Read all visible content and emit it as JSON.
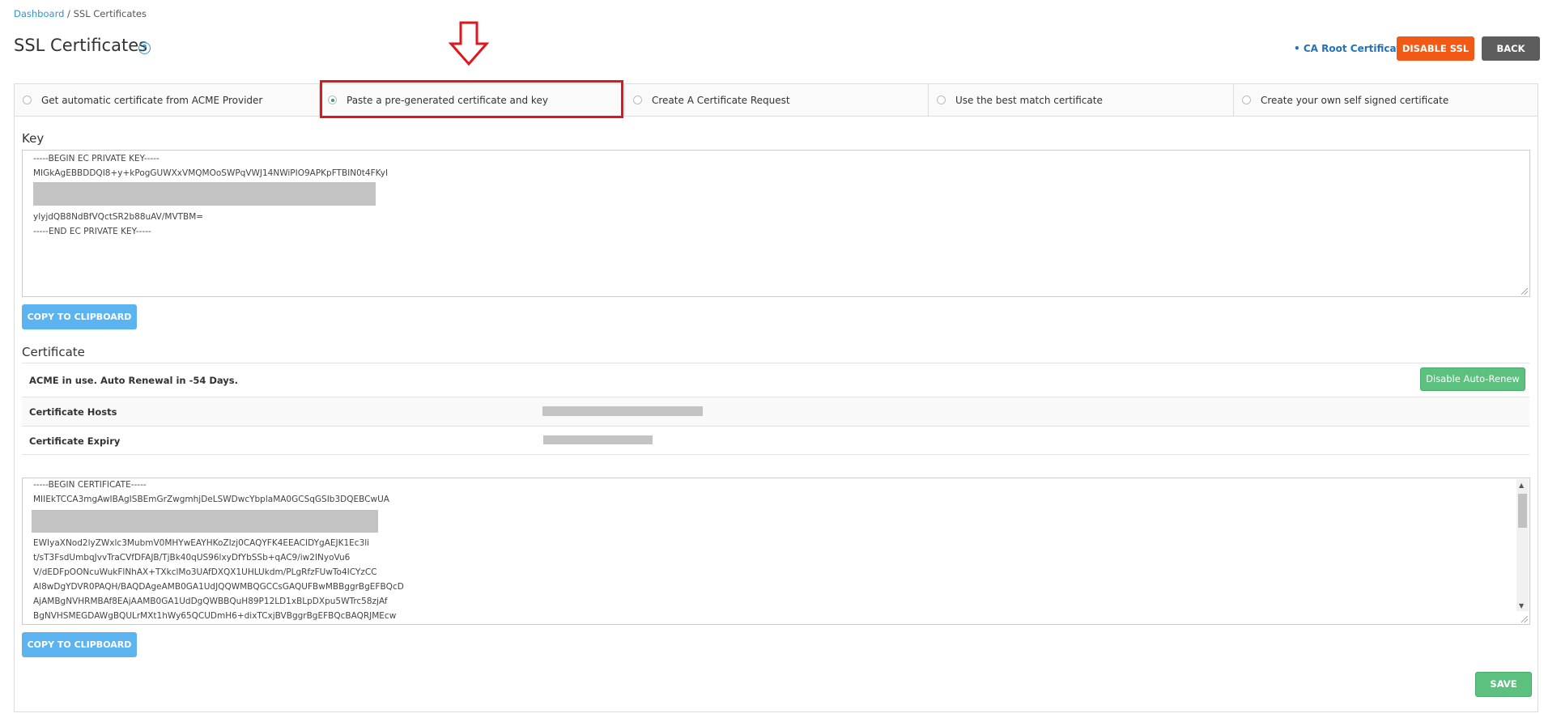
{
  "breadcrumb": {
    "home": "Dashboard",
    "separator": " / ",
    "current": "SSL Certificates"
  },
  "page": {
    "title": "SSL Certificates",
    "help": "?"
  },
  "header_actions": {
    "ca_link": "• CA Root Certificate",
    "disable_ssl": "DISABLE SSL",
    "back": "BACK"
  },
  "tabs": [
    {
      "label": "Get automatic certificate from ACME Provider",
      "selected": false
    },
    {
      "label": "Paste a pre-generated certificate and key",
      "selected": true
    },
    {
      "label": "Create A Certificate Request",
      "selected": false
    },
    {
      "label": "Use the best match certificate",
      "selected": false
    },
    {
      "label": "Create your own self signed certificate",
      "selected": false
    }
  ],
  "key": {
    "label": "Key",
    "lines": [
      "-----BEGIN EC PRIVATE KEY-----",
      "MIGkAgEBBDDQI8+y+kPogGUWXxVMQMOoSWPqVWJ14NWiPIO9APKpFTBIN0t4FKyI",
      "ylyjdQB8NdBfVQctSR2b88uAV/MVTBM=",
      "-----END EC PRIVATE KEY-----"
    ],
    "copy_button": "COPY TO CLIPBOARD"
  },
  "certificate": {
    "label": "Certificate",
    "acme_status": "ACME in use. Auto Renewal in -54 Days.",
    "disable_autorenew": "Disable Auto-Renew",
    "hosts_label": "Certificate Hosts",
    "expiry_label": "Certificate Expiry",
    "lines": [
      "-----BEGIN CERTIFICATE-----",
      "MIIEkTCCA3mgAwIBAgISBEmGrZwgmhjDeLSWDwcYbplaMA0GCSqGSIb3DQEBCwUA",
      "EWIyaXNod2lyZWxlc3MubmV0MHYwEAYHKoZIzj0CAQYFK4EEACIDYgAEJK1Ec3li",
      "t/sT3FsdUmbqJvvTraCVfDFAJB/TjBk40qUS96lxyDfYbSSb+qAC9/iw2INyoVu6",
      "V/dEDFpOONcuWukFlNhAX+TXkclMo3UAfDXQX1UHLUkdm/PLgRfzFUwTo4ICYzCC",
      "Al8wDgYDVR0PAQH/BAQDAgeAMB0GA1UdJQQWMBQGCCsGAQUFBwMBBggrBgEFBQcD",
      "AjAMBgNVHRMBAf8EAjAAMB0GA1UdDgQWBBQuH89P12LD1xBLpDXpu5WTrc58zjAf",
      "BgNVHSMEGDAWgBQULrMXt1hWy65QCUDmH6+dixTCxjBVBggrBgEFBQcBAQRJMEcw"
    ],
    "copy_button": "COPY TO CLIPBOARD"
  },
  "save_button": "SAVE",
  "colors": {
    "accent_orange": "#f05a16",
    "back_grey": "#5d5d5d",
    "link_blue": "#2173b8",
    "copy_blue": "#5bb3ef",
    "save_green": "#5cc07f",
    "highlight_red": "#e0161e"
  }
}
